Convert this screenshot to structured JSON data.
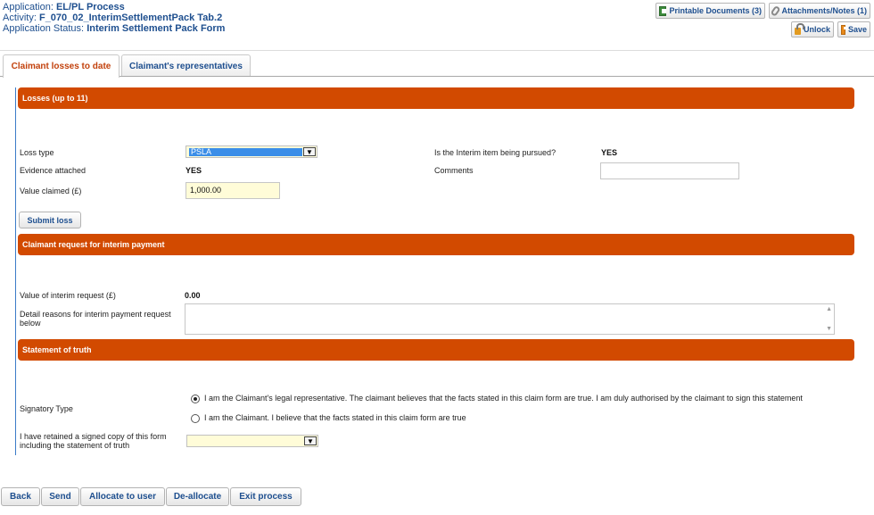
{
  "header": {
    "application_label": "Application:",
    "application_value": "EL/PL Process",
    "activity_label": "Activity:",
    "activity_value": "F_070_02_InterimSettlementPack Tab.2",
    "status_label": "Application Status:",
    "status_value": "Interim Settlement Pack Form"
  },
  "toolbar": {
    "printable_docs": "Printable Documents (3)",
    "attachments": "Attachments/Notes (1)",
    "unlock": "Unlock",
    "save": "Save"
  },
  "tabs": [
    {
      "label": "Claimant losses to date",
      "active": true
    },
    {
      "label": "Claimant's representatives",
      "active": false
    }
  ],
  "losses": {
    "section_title": "Losses (up to 11)",
    "loss_type_label": "Loss type",
    "loss_type_value": "PSLA",
    "interim_pursued_label": "Is the Interim item being pursued?",
    "interim_pursued_value": "YES",
    "evidence_label": "Evidence attached",
    "evidence_value": "YES",
    "comments_label": "Comments",
    "comments_value": "",
    "value_claimed_label": "Value claimed (£)",
    "value_claimed_value": "1,000.00",
    "submit_label": "Submit loss"
  },
  "interim_request": {
    "section_title": "Claimant request for interim payment",
    "value_label": "Value of interim request (£)",
    "value_value": "0.00",
    "reasons_label": "Detail reasons for interim payment request below",
    "reasons_value": ""
  },
  "statement": {
    "section_title": "Statement of truth",
    "signatory_label": "Signatory Type",
    "option1": "I am the Claimant's legal representative. The claimant believes that the facts stated in this claim form are true. I am duly authorised by the claimant to sign this statement",
    "option2": "I am the Claimant. I believe that the facts stated in this claim form are true",
    "selected_option": 1,
    "retained_label": "I have retained a signed copy of this form including the statement of truth",
    "retained_value": ""
  },
  "footer": {
    "back": "Back",
    "send": "Send",
    "allocate": "Allocate to user",
    "deallocate": "De-allocate",
    "exit": "Exit process"
  },
  "colors": {
    "section_header": "#d24a00",
    "link_blue": "#1e4f8f",
    "active_tab": "#c2410c",
    "input_yellow": "#fffcd8"
  }
}
